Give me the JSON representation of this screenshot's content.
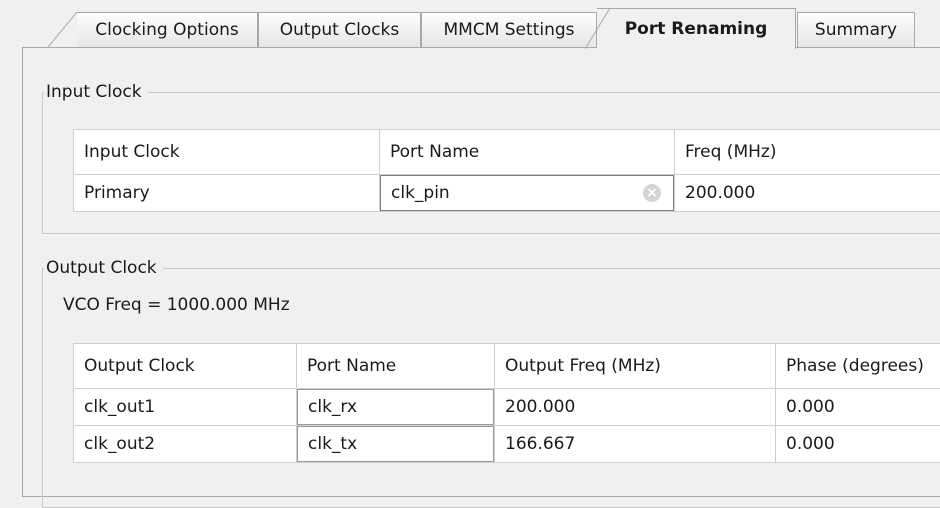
{
  "tabs": [
    {
      "label": "Clocking Options",
      "active": false
    },
    {
      "label": "Output Clocks",
      "active": false
    },
    {
      "label": "MMCM Settings",
      "active": false
    },
    {
      "label": "Port Renaming",
      "active": true
    },
    {
      "label": "Summary",
      "active": false
    }
  ],
  "input_clock": {
    "title": "Input Clock",
    "headers": [
      "Input Clock",
      "Port Name",
      "Freq (MHz)"
    ],
    "rows": [
      {
        "clock": "Primary",
        "port": "clk_pin",
        "freq": "200.000"
      }
    ]
  },
  "output_clock": {
    "title": "Output Clock",
    "vco": "VCO Freq = 1000.000 MHz",
    "headers": [
      "Output Clock",
      "Port Name",
      "Output Freq (MHz)",
      "Phase (degrees)"
    ],
    "rows": [
      {
        "clock": "clk_out1",
        "port": "clk_rx",
        "freq": "200.000",
        "phase": "0.000"
      },
      {
        "clock": "clk_out2",
        "port": "clk_tx",
        "freq": "166.667",
        "phase": "0.000"
      }
    ]
  }
}
